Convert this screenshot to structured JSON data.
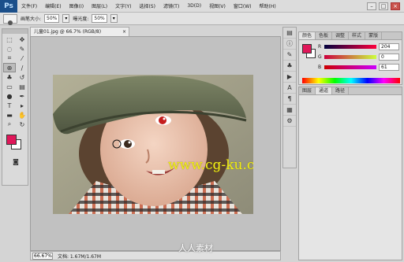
{
  "app": {
    "logo": "Ps"
  },
  "menu": [
    "文件(F)",
    "编辑(E)",
    "图像(I)",
    "图层(L)",
    "文字(Y)",
    "选择(S)",
    "滤镜(T)",
    "3D(D)",
    "视图(V)",
    "窗口(W)",
    "帮助(H)"
  ],
  "options": {
    "brush_size_label": "画笔大小:",
    "brush_size_value": "50%",
    "exposure_label": "曝光度:",
    "exposure_value": "50%"
  },
  "document": {
    "tab_title": "儿童01.jpg @ 66.7% (RGB/8)",
    "tab_close": "×",
    "watermark": "www.cg-ku.com"
  },
  "status": {
    "zoom": "66.67%",
    "doc_info": "文档: 1.67M/1.67M"
  },
  "bottom_watermark": "人人素材",
  "color_panel": {
    "tabs": [
      "颜色",
      "色板",
      "调整",
      "样式",
      "蒙版"
    ],
    "r_label": "R",
    "g_label": "G",
    "b_label": "B",
    "r_value": "204",
    "g_value": "0",
    "b_value": "61",
    "foreground_color": "#e0175a",
    "background_color": "#ffffff"
  },
  "history_panel": {
    "tabs": [
      "图层",
      "通道",
      "路径"
    ]
  },
  "toolbox": {
    "tools": [
      "move-tool-icon",
      "marquee-icon",
      "lasso-icon",
      "quick-select-icon",
      "crop-icon",
      "eyedropper-icon",
      "healing-brush-icon",
      "brush-icon",
      "clone-stamp-icon",
      "history-brush-icon",
      "eraser-icon",
      "gradient-icon",
      "dodge-icon",
      "pen-icon",
      "type-icon",
      "path-select-icon",
      "shape-icon",
      "hand-icon",
      "zoom-icon",
      "rotate-icon"
    ]
  }
}
